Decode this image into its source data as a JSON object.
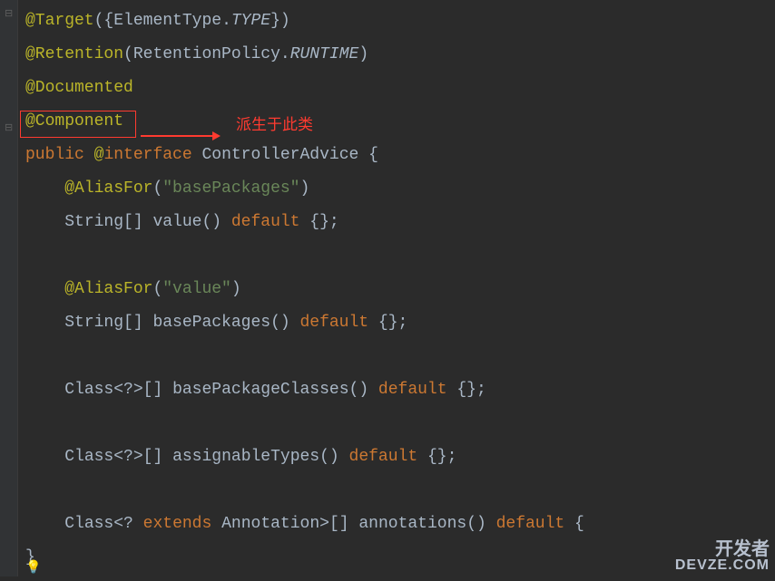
{
  "annotation": {
    "text": "派生于此类"
  },
  "watermark": {
    "line1": "开发者",
    "line2": "DEVZE.COM"
  },
  "tokens": {
    "at": "@",
    "target": "@Target",
    "elementType": "ElementType",
    "typeConst": "TYPE",
    "retention": "@Retention",
    "retentionPolicy": "RetentionPolicy",
    "runtime": "RUNTIME",
    "documented": "@Documented",
    "component": "@Component",
    "publicKw": "public",
    "interfaceKw": "interface",
    "className": "ControllerAdvice",
    "aliasFor": "@AliasFor",
    "basePackagesStr": "\"basePackages\"",
    "valueStr": "\"value\"",
    "stringType": "String",
    "classType": "Class",
    "annotationType": "Annotation",
    "valueMethod": "value",
    "basePackagesMethod": "basePackages",
    "basePackageClassesMethod": "basePackageClasses",
    "assignableTypesMethod": "assignableTypes",
    "annotationsMethod": "annotations",
    "defaultKw": "default",
    "extendsKw": "extends",
    "emptyArr": "{}",
    "wildcard": "?",
    "openBrace": "{",
    "closeBrace": "}",
    "semicolon": ";",
    "lparen": "(",
    "rparen": ")",
    "lbracket": "[",
    "rbracket": "]",
    "lt": "<",
    "gt": ">",
    "dot": "."
  }
}
